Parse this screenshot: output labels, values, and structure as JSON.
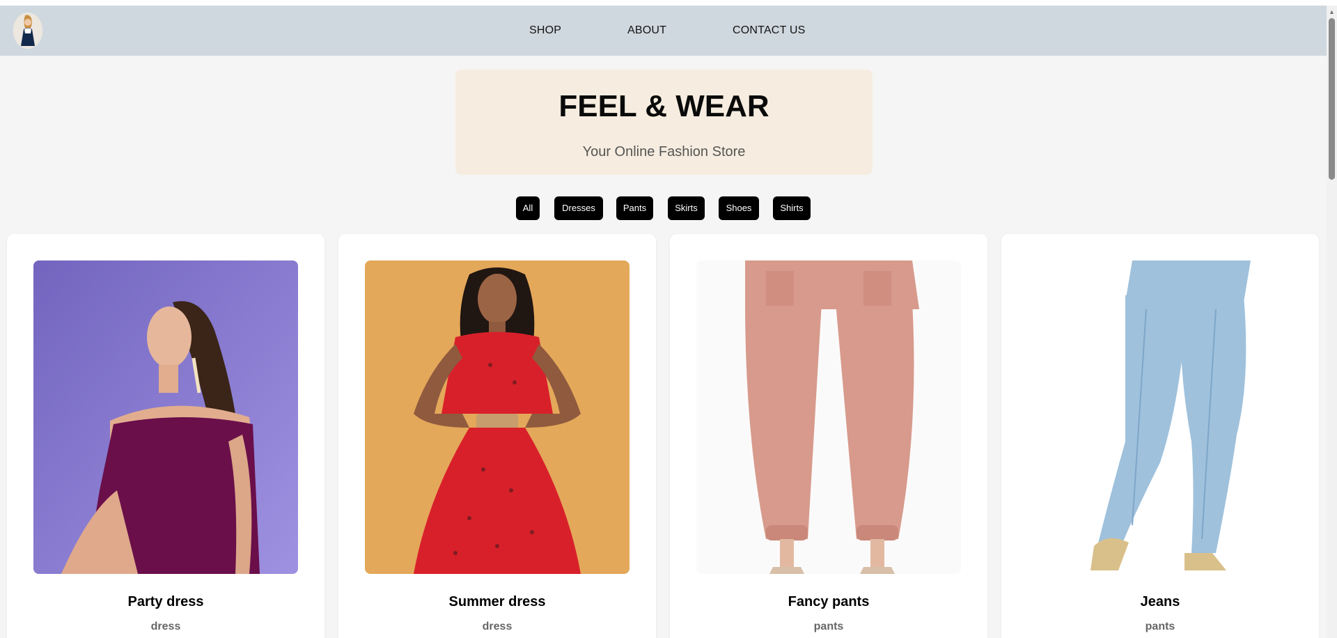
{
  "nav": {
    "links": [
      "SHOP",
      "ABOUT",
      "CONTACT US"
    ]
  },
  "hero": {
    "title": "FEEL & WEAR",
    "subtitle": "Your Online Fashion Store"
  },
  "filters": [
    "All",
    "Dresses",
    "Pants",
    "Skirts",
    "Shoes",
    "Shirts"
  ],
  "products": [
    {
      "name": "Party dress",
      "category": "dress",
      "image_bg": "#8d7cd6",
      "garment_color": "#6a0f4a"
    },
    {
      "name": "Summer dress",
      "category": "dress",
      "image_bg": "#e4a85a",
      "garment_color": "#d8202a"
    },
    {
      "name": "Fancy pants",
      "category": "pants",
      "image_bg": "#fbfafa",
      "garment_color": "#d79a8c"
    },
    {
      "name": "Jeans",
      "category": "pants",
      "image_bg": "#ffffff",
      "garment_color": "#9fc1dc"
    }
  ],
  "colors": {
    "navbar": "#d0d8df",
    "hero_bg": "#f6ede0",
    "page_bg": "#f5f5f5",
    "filter_bg": "#000000"
  }
}
